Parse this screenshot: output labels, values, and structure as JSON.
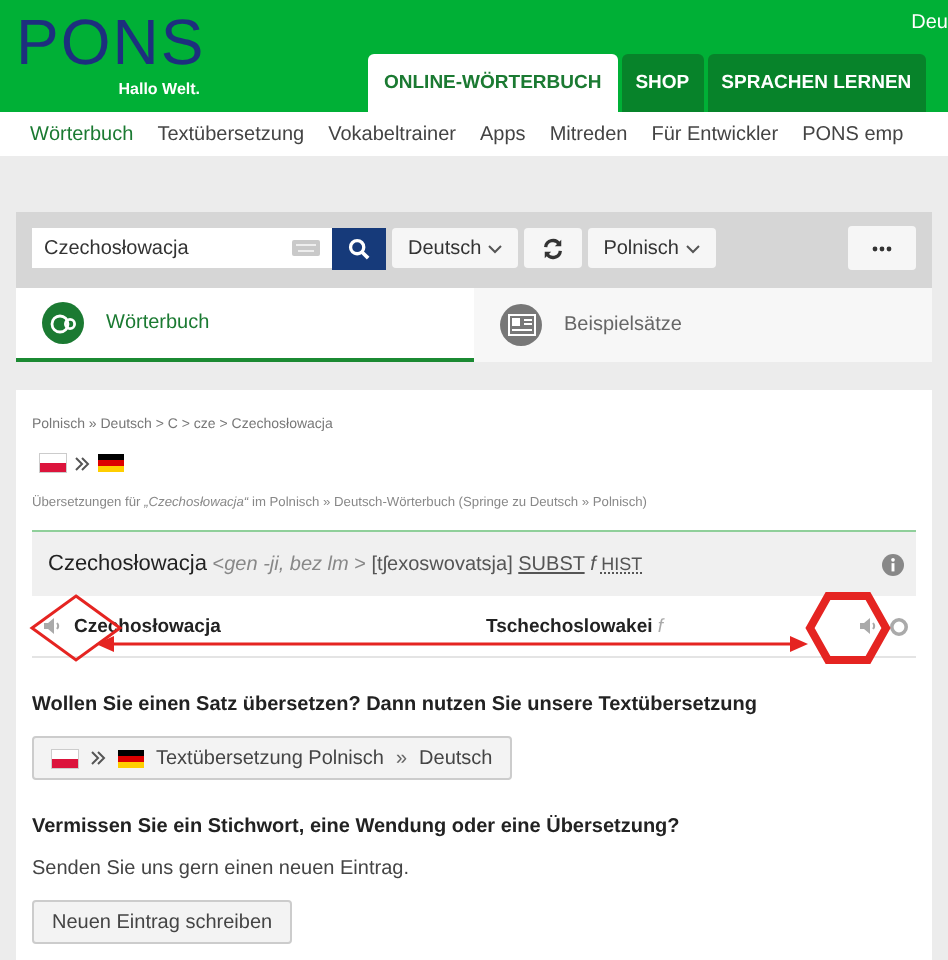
{
  "header": {
    "logo": "PONS",
    "tagline": "Hallo Welt.",
    "language": "Deu",
    "tabs": [
      {
        "label": "ONLINE-WÖRTERBUCH",
        "selected": true
      },
      {
        "label": "SHOP",
        "selected": false
      },
      {
        "label": "SPRACHEN LERNEN",
        "selected": false
      }
    ]
  },
  "nav": [
    {
      "label": "Wörterbuch",
      "selected": true
    },
    {
      "label": "Textübersetzung",
      "selected": false
    },
    {
      "label": "Vokabeltrainer",
      "selected": false
    },
    {
      "label": "Apps",
      "selected": false
    },
    {
      "label": "Mitreden",
      "selected": false
    },
    {
      "label": "Für Entwickler",
      "selected": false
    },
    {
      "label": "PONS emp",
      "selected": false
    }
  ],
  "search": {
    "value": "Czechosłowacja",
    "source": "Deutsch",
    "target": "Polnisch"
  },
  "modes": [
    {
      "label": "Wörterbuch",
      "selected": true
    },
    {
      "label": "Beispielsätze",
      "selected": false
    }
  ],
  "breadcrumb": "Polnisch » Deutsch > C > cze > Czechosłowacja",
  "note": "Übersetzungen für *„Czechosłowacja“* im Polnisch » Deutsch-Wörterbuch (Springe zu Deutsch » Polnisch)",
  "entry": {
    "headword": "Czechosłowacja",
    "grammar": "<*gen -ji, bez lm* >",
    "phonetics": "[tʃexoswovatsja]",
    "pos": "SUBST",
    "gender": "f",
    "label": "HIST",
    "translations": [
      {
        "source": "Czechosłowacja",
        "target": "Tschechoslowakei",
        "gender": "f"
      }
    ]
  },
  "text_translation": {
    "heading": "Wollen Sie einen Satz übersetzen? Dann nutzen Sie unsere Textübersetzung",
    "button_from": "Textübersetzung Polnisch",
    "arrow": "»",
    "button_to": "Deutsch"
  },
  "missing": {
    "heading": "Vermissen Sie ein Stichwort, eine Wendung oder eine Übersetzung?",
    "text": "Senden Sie uns gern einen neuen Eintrag.",
    "button": "Neuen Eintrag schreiben"
  },
  "annotations": [
    {
      "kind": "diamond",
      "color": "#e52421"
    },
    {
      "kind": "hexagon",
      "color": "#e52421"
    },
    {
      "kind": "arrow",
      "color": "#e52421"
    }
  ]
}
